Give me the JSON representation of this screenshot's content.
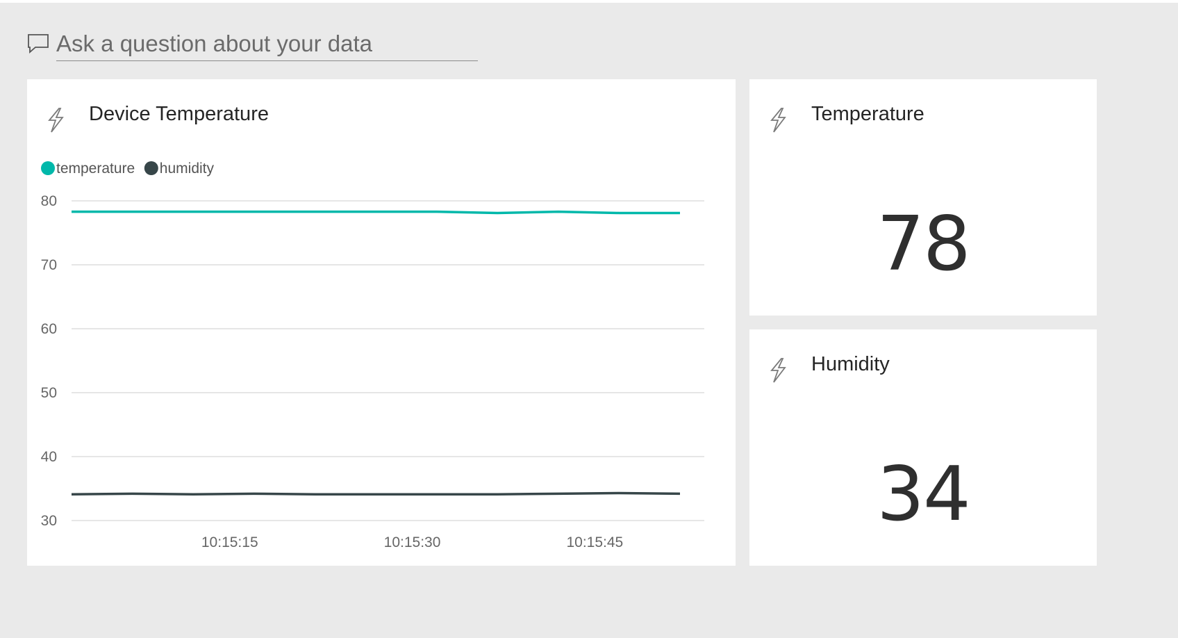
{
  "qa": {
    "placeholder": "Ask a question about your data",
    "icon": "speech-bubble-icon"
  },
  "tiles": {
    "device_temperature": {
      "title": "Device Temperature",
      "icon": "lightning-icon"
    },
    "temperature": {
      "title": "Temperature",
      "value": "78",
      "icon": "lightning-icon"
    },
    "humidity": {
      "title": "Humidity",
      "value": "34",
      "icon": "lightning-icon"
    }
  },
  "chart_data": {
    "type": "line",
    "title": "Device Temperature",
    "xlabel": "",
    "ylabel": "",
    "x_ticks": [
      "10:15:15",
      "10:15:30",
      "10:15:45"
    ],
    "y_ticks": [
      30,
      40,
      50,
      60,
      70,
      80
    ],
    "ylim": [
      30,
      80
    ],
    "grid": true,
    "legend_position": "top-left",
    "series": [
      {
        "name": "temperature",
        "color": "#01b8aa",
        "values": [
          78.3,
          78.3,
          78.3,
          78.3,
          78.3,
          78.3,
          78.3,
          78.1,
          78.3,
          78.1,
          78.1
        ]
      },
      {
        "name": "humidity",
        "color": "#374649",
        "values": [
          34.1,
          34.2,
          34.1,
          34.2,
          34.1,
          34.1,
          34.1,
          34.1,
          34.2,
          34.3,
          34.2
        ]
      }
    ]
  },
  "colors": {
    "background": "#eaeaea",
    "tile": "#ffffff",
    "gridline": "#e6e6e6"
  }
}
